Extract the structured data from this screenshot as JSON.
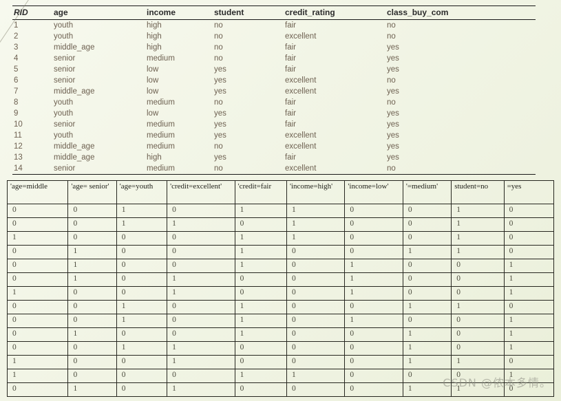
{
  "decoration": {
    "diagonal_line": "faint-diagonal-line"
  },
  "training_table": {
    "headers": [
      "RID",
      "age",
      "income",
      "student",
      "credit_rating",
      "class_buy_com"
    ],
    "rows": [
      [
        "1",
        "youth",
        "high",
        "no",
        "fair",
        "no"
      ],
      [
        "2",
        "youth",
        "high",
        "no",
        "excellent",
        "no"
      ],
      [
        "3",
        "middle_age",
        "high",
        "no",
        "fair",
        "yes"
      ],
      [
        "4",
        "senior",
        "medium",
        "no",
        "fair",
        "yes"
      ],
      [
        "5",
        "senior",
        "low",
        "yes",
        "fair",
        "yes"
      ],
      [
        "6",
        "senior",
        "low",
        "yes",
        "excellent",
        "no"
      ],
      [
        "7",
        "middle_age",
        "low",
        "yes",
        "excellent",
        "yes"
      ],
      [
        "8",
        "youth",
        "medium",
        "no",
        "fair",
        "no"
      ],
      [
        "9",
        "youth",
        "low",
        "yes",
        "fair",
        "yes"
      ],
      [
        "10",
        "senior",
        "medium",
        "yes",
        "fair",
        "yes"
      ],
      [
        "11",
        "youth",
        "medium",
        "yes",
        "excellent",
        "yes"
      ],
      [
        "12",
        "middle_age",
        "medium",
        "no",
        "excellent",
        "yes"
      ],
      [
        "13",
        "middle_age",
        "high",
        "yes",
        "fair",
        "yes"
      ],
      [
        "14",
        "senior",
        "medium",
        "no",
        "excellent",
        "no"
      ]
    ]
  },
  "binary_table": {
    "headers": [
      "'age=middle",
      "'age= senior'",
      "'age=youth",
      "'credit=excellent'",
      "'credit=fair",
      "'income=high'",
      "'income=low'",
      "'=medium'",
      "student=no",
      "=yes"
    ],
    "rows": [
      [
        "0",
        "0",
        "1",
        "0",
        "1",
        "1",
        "0",
        "0",
        "1",
        "0"
      ],
      [
        "0",
        "0",
        "1",
        "1",
        "0",
        "1",
        "0",
        "0",
        "1",
        "0"
      ],
      [
        "1",
        "0",
        "0",
        "0",
        "1",
        "1",
        "0",
        "0",
        "1",
        "0"
      ],
      [
        "0",
        "1",
        "0",
        "0",
        "1",
        "0",
        "0",
        "1",
        "1",
        "0"
      ],
      [
        "0",
        "1",
        "0",
        "0",
        "1",
        "0",
        "1",
        "0",
        "0",
        "1"
      ],
      [
        "0",
        "1",
        "0",
        "1",
        "0",
        "0",
        "1",
        "0",
        "0",
        "1"
      ],
      [
        "1",
        "0",
        "0",
        "1",
        "0",
        "0",
        "1",
        "0",
        "0",
        "1"
      ],
      [
        "0",
        "0",
        "1",
        "0",
        "1",
        "0",
        "0",
        "1",
        "1",
        "0"
      ],
      [
        "0",
        "0",
        "1",
        "0",
        "1",
        "0",
        "1",
        "0",
        "0",
        "1"
      ],
      [
        "0",
        "1",
        "0",
        "0",
        "1",
        "0",
        "0",
        "1",
        "0",
        "1"
      ],
      [
        "0",
        "0",
        "1",
        "1",
        "0",
        "0",
        "0",
        "1",
        "0",
        "1"
      ],
      [
        "1",
        "0",
        "0",
        "1",
        "0",
        "0",
        "0",
        "1",
        "1",
        "0"
      ],
      [
        "1",
        "0",
        "0",
        "0",
        "1",
        "1",
        "0",
        "0",
        "0",
        "1"
      ],
      [
        "0",
        "1",
        "0",
        "1",
        "0",
        "0",
        "0",
        "1",
        "1",
        "0"
      ]
    ]
  },
  "watermark": {
    "text": "CSDN @侬本多情。"
  }
}
